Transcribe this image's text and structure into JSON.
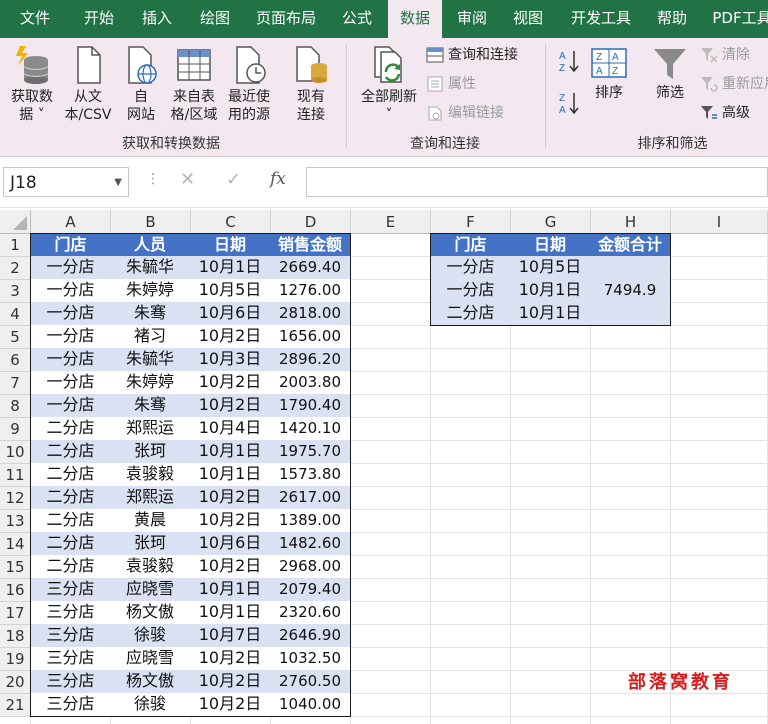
{
  "tabs": [
    {
      "label": "文件",
      "active": false
    },
    {
      "label": "开始",
      "active": false
    },
    {
      "label": "插入",
      "active": false
    },
    {
      "label": "绘图",
      "active": false
    },
    {
      "label": "页面布局",
      "active": false
    },
    {
      "label": "公式",
      "active": false
    },
    {
      "label": "数据",
      "active": true
    },
    {
      "label": "审阅",
      "active": false
    },
    {
      "label": "视图",
      "active": false
    },
    {
      "label": "开发工具",
      "active": false
    },
    {
      "label": "帮助",
      "active": false
    },
    {
      "label": "PDF工具",
      "active": false
    }
  ],
  "ribbon": {
    "get_data": {
      "line1": "获取数",
      "line2": "据 ˅"
    },
    "from_csv": {
      "line1": "从文",
      "line2": "本/CSV"
    },
    "from_web": {
      "line1": "自",
      "line2": "网站"
    },
    "from_table": {
      "line1": "来自表",
      "line2": "格/区域"
    },
    "recent_sources": {
      "line1": "最近使",
      "line2": "用的源"
    },
    "existing_connections": {
      "line1": "现有",
      "line2": "连接"
    },
    "group_get_transform": "获取和转换数据",
    "refresh_all": {
      "line1": "全部刷新",
      "line2": "˅"
    },
    "queries_connections": "查询和连接",
    "properties": "属性",
    "edit_links": "编辑链接",
    "group_queries": "查询和连接",
    "sort": "排序",
    "filter": "筛选",
    "clear": "清除",
    "reapply": "重新应用",
    "advanced": "高级",
    "group_sort_filter": "排序和筛选"
  },
  "formula_bar": {
    "name_box": "J18",
    "cancel": "✕",
    "enter": "✓",
    "fx": "fx",
    "formula": ""
  },
  "columns": [
    "A",
    "B",
    "C",
    "D",
    "E",
    "F",
    "G",
    "H",
    "I"
  ],
  "rows": [
    "1",
    "2",
    "3",
    "4",
    "5",
    "6",
    "7",
    "8",
    "9",
    "10",
    "11",
    "12",
    "13",
    "14",
    "15",
    "16",
    "17",
    "18",
    "19",
    "20",
    "21"
  ],
  "main_table": {
    "headers": [
      "门店",
      "人员",
      "日期",
      "销售金额"
    ],
    "rows": [
      [
        "一分店",
        "朱毓华",
        "10月1日",
        "2669.40"
      ],
      [
        "一分店",
        "朱婷婷",
        "10月5日",
        "1276.00"
      ],
      [
        "一分店",
        "朱骞",
        "10月6日",
        "2818.00"
      ],
      [
        "一分店",
        "褚习",
        "10月2日",
        "1656.00"
      ],
      [
        "一分店",
        "朱毓华",
        "10月3日",
        "2896.20"
      ],
      [
        "一分店",
        "朱婷婷",
        "10月2日",
        "2003.80"
      ],
      [
        "一分店",
        "朱骞",
        "10月2日",
        "1790.40"
      ],
      [
        "二分店",
        "郑熙运",
        "10月4日",
        "1420.10"
      ],
      [
        "二分店",
        "张珂",
        "10月1日",
        "1975.70"
      ],
      [
        "二分店",
        "袁骏毅",
        "10月1日",
        "1573.80"
      ],
      [
        "二分店",
        "郑熙运",
        "10月2日",
        "2617.00"
      ],
      [
        "二分店",
        "黄晨",
        "10月2日",
        "1389.00"
      ],
      [
        "二分店",
        "张珂",
        "10月6日",
        "1482.60"
      ],
      [
        "二分店",
        "袁骏毅",
        "10月2日",
        "2968.00"
      ],
      [
        "三分店",
        "应晓雪",
        "10月1日",
        "2079.40"
      ],
      [
        "三分店",
        "杨文傲",
        "10月1日",
        "2320.60"
      ],
      [
        "三分店",
        "徐骏",
        "10月7日",
        "2646.90"
      ],
      [
        "三分店",
        "应晓雪",
        "10月2日",
        "1032.50"
      ],
      [
        "三分店",
        "杨文傲",
        "10月2日",
        "2760.50"
      ],
      [
        "三分店",
        "徐骏",
        "10月2日",
        "1040.00"
      ]
    ]
  },
  "criteria_table": {
    "headers": [
      "门店",
      "日期",
      "金额合计"
    ],
    "rows": [
      [
        "一分店",
        "10月5日"
      ],
      [
        "一分店",
        "10月1日"
      ],
      [
        "二分店",
        "10月1日"
      ]
    ],
    "total": "7494.9"
  },
  "watermark": "部落窝教育",
  "colors": {
    "ribbon_green": "#217346",
    "header_blue": "#4472c4",
    "band_blue": "#d9e1f2",
    "ribbon_bg": "#f3e8f0",
    "watermark_red": "#d81e1e"
  }
}
